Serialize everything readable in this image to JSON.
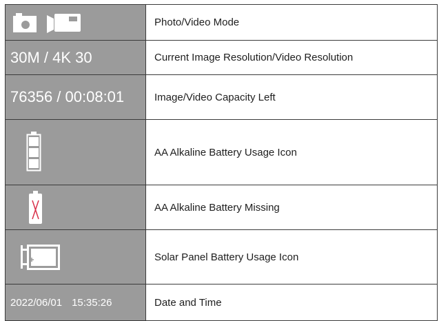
{
  "rows": [
    {
      "left_icons": [
        "camera-icon",
        "video-camera-icon"
      ],
      "description": "Photo/Video Mode"
    },
    {
      "left_text": "30M / 4K 30",
      "description": "Current Image Resolution/Video Resolution"
    },
    {
      "left_text": "76356 / 00:08:01",
      "description": "Image/Video Capacity Left"
    },
    {
      "left_icons": [
        "battery-full-icon"
      ],
      "description": "AA Alkaline Battery Usage Icon"
    },
    {
      "left_icons": [
        "battery-missing-icon"
      ],
      "description": "AA Alkaline Battery Missing"
    },
    {
      "left_icons": [
        "solar-battery-icon"
      ],
      "description": "Solar Panel Battery Usage Icon"
    },
    {
      "left_text_parts": [
        "2022/06/01",
        "15:35:26"
      ],
      "description": "Date and Time"
    }
  ],
  "colors": {
    "cell_gray": "#9b9b9b",
    "icon_white": "#ffffff",
    "missing_x": "#d9304a",
    "border": "#3a3a3a"
  }
}
